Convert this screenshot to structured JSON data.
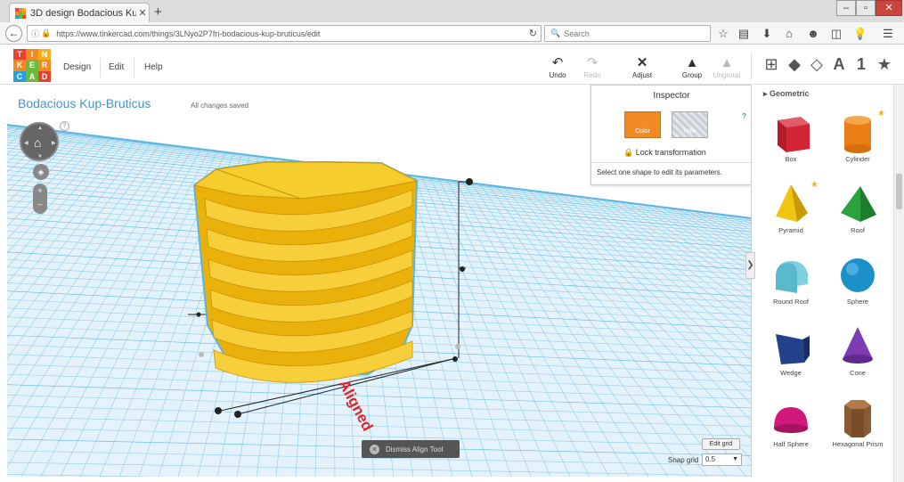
{
  "browser": {
    "tab_title": "3D design Bodacious Kup-...",
    "url": "https://www.tinkercad.com/things/3LNyo2P7fri-bodacious-kup-bruticus/edit",
    "search_placeholder": "Search"
  },
  "app": {
    "logo_letters": [
      "T",
      "I",
      "N",
      "K",
      "E",
      "R",
      "C",
      "A",
      "D"
    ],
    "logo_colors": [
      "#e8412c",
      "#f28a24",
      "#f2b01e",
      "#f28a24",
      "#6dbb3c",
      "#f28a24",
      "#2a9fd6",
      "#6dbb3c",
      "#e8412c"
    ],
    "menu": [
      "Design",
      "Edit",
      "Help"
    ],
    "tools": {
      "undo": "Undo",
      "redo": "Redo",
      "adjust": "Adjust",
      "group": "Group",
      "ungroup": "Ungroup"
    },
    "view_letter": "A",
    "view_number": "1"
  },
  "workplane": {
    "design_title": "Bodacious Kup-Bruticus",
    "save_status": "All changes saved",
    "help": "?",
    "aligned_label": "Aligned",
    "dismiss_label": "Dismiss Align Tool",
    "edit_grid_label": "Edit grid",
    "snap_grid_label": "Snap grid",
    "snap_grid_value": "0.5"
  },
  "inspector": {
    "title": "Inspector",
    "color_label": "Color",
    "hole_label": "Hole",
    "help": "?",
    "lock_label": "Lock transformation",
    "hint": "Select one shape to edit its parameters."
  },
  "sidebar": {
    "category": "Geometric",
    "shapes": [
      {
        "label": "Box"
      },
      {
        "label": "Cylinder"
      },
      {
        "label": "Pyramid"
      },
      {
        "label": "Roof"
      },
      {
        "label": "Round Roof"
      },
      {
        "label": "Sphere"
      },
      {
        "label": "Wedge"
      },
      {
        "label": "Cone"
      },
      {
        "label": "Half Sphere"
      },
      {
        "label": "Hexagonal Prism"
      }
    ]
  },
  "colors": {
    "accent": "#4a94c6",
    "shape_yellow": "#f5c518",
    "grid_line": "#5ab6e0"
  }
}
